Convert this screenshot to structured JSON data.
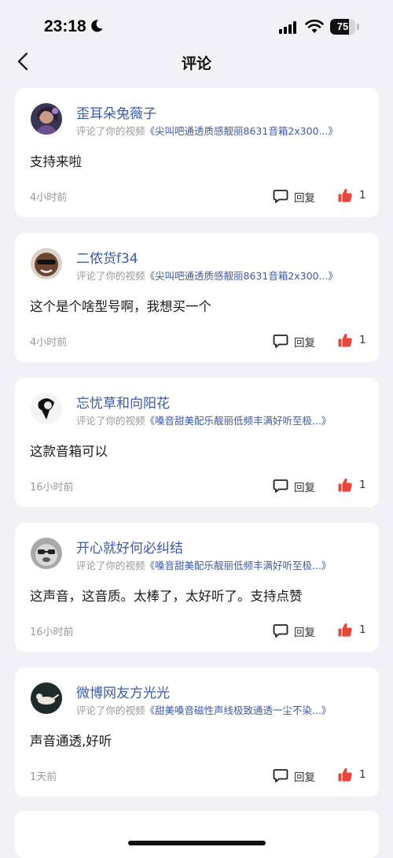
{
  "status_bar": {
    "time": "23:18",
    "battery": "75",
    "battery_level": 0.75
  },
  "header": {
    "title": "评论"
  },
  "comments": [
    {
      "username": "歪耳朵兔薇子",
      "action": "评论了你的视频",
      "video_title": "《尖叫吧通透质感靓丽8631音箱2x300...》",
      "text": "支持来啦",
      "time": "4小时前",
      "reply_label": "回复",
      "likes": "1"
    },
    {
      "username": "二侬货f34",
      "action": "评论了你的视频",
      "video_title": "《尖叫吧通透质感靓丽8631音箱2x300...》",
      "text": "这个是个啥型号啊，我想买一个",
      "time": "4小时前",
      "reply_label": "回复",
      "likes": "1"
    },
    {
      "username": "忘忧草和向阳花",
      "action": "评论了你的视频",
      "video_title": "《嗓音甜美配乐靓丽低频丰满好听至极...》",
      "text": "这款音箱可以",
      "time": "16小时前",
      "reply_label": "回复",
      "likes": "1"
    },
    {
      "username": "开心就好何必纠结",
      "action": "评论了你的视频",
      "video_title": "《嗓音甜美配乐靓丽低频丰满好听至极...》",
      "text": "这声音，这音质。太棒了，太好听了。支持点赞",
      "time": "16小时前",
      "reply_label": "回复",
      "likes": "1"
    },
    {
      "username": "微博网友方光光",
      "action": "评论了你的视频",
      "video_title": "《甜美嗓音磁性声线极致通透一尘不染...》",
      "text": "声音通透,好听",
      "time": "1天前",
      "reply_label": "回复",
      "likes": "1"
    }
  ],
  "colors": {
    "link": "#3b5aa8",
    "like": "#e8453c",
    "background": "#f2f2f6"
  },
  "icons": {
    "back": "chevron-left-icon",
    "reply": "comment-bubble-icon",
    "like": "thumbs-up-icon"
  }
}
